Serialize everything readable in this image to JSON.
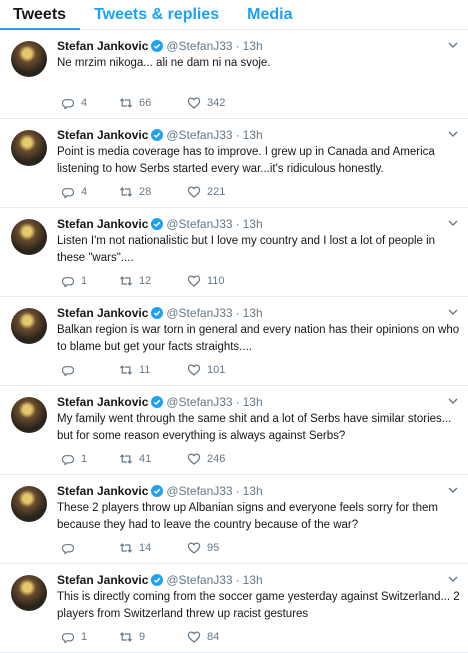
{
  "tabs": [
    "Tweets",
    "Tweets & replies",
    "Media"
  ],
  "colors": {
    "accent": "#1da1f2",
    "text": "#14171a",
    "muted": "#657786",
    "divider": "#e6ecf0"
  },
  "icons": {
    "reply": "reply-icon",
    "retweet": "retweet-icon",
    "like": "heart-icon",
    "verified": "verified-badge-icon",
    "more": "chevron-down-icon"
  },
  "tweets": [
    {
      "name": "Stefan Jankovic",
      "handle": "@StefanJ33",
      "time": "13h",
      "text": "Ne mrzim nikoga... ali ne dam ni na svoje.",
      "replies": "4",
      "retweets": "66",
      "likes": "342"
    },
    {
      "name": "Stefan Jankovic",
      "handle": "@StefanJ33",
      "time": "13h",
      "text": "Point is media coverage has to improve. I grew up in Canada and America listening to how Serbs started every war...it's ridiculous honestly.",
      "replies": "4",
      "retweets": "28",
      "likes": "221"
    },
    {
      "name": "Stefan Jankovic",
      "handle": "@StefanJ33",
      "time": "13h",
      "text": "Listen I'm not nationalistic but I love my country and I lost a lot of people in these \"wars\"....",
      "replies": "1",
      "retweets": "12",
      "likes": "110"
    },
    {
      "name": "Stefan Jankovic",
      "handle": "@StefanJ33",
      "time": "13h",
      "text": "Balkan region is war torn in general and every nation has their opinions on  who to blame but get your facts straights....",
      "replies": "",
      "retweets": "11",
      "likes": "101"
    },
    {
      "name": "Stefan Jankovic",
      "handle": "@StefanJ33",
      "time": "13h",
      "text": "My family went through the same shit and a lot of Serbs have similar stories... but for some reason everything is always against Serbs?",
      "replies": "1",
      "retweets": "41",
      "likes": "246"
    },
    {
      "name": "Stefan Jankovic",
      "handle": "@StefanJ33",
      "time": "13h",
      "text": "These 2 players throw up Albanian signs and everyone feels sorry for them because they had to leave the country because of the war?",
      "replies": "",
      "retweets": "14",
      "likes": "95"
    },
    {
      "name": "Stefan Jankovic",
      "handle": "@StefanJ33",
      "time": "13h",
      "text": "This is directly coming from the soccer game yesterday against Switzerland... 2 players from Switzerland threw up racist gestures",
      "replies": "1",
      "retweets": "9",
      "likes": "84"
    }
  ]
}
